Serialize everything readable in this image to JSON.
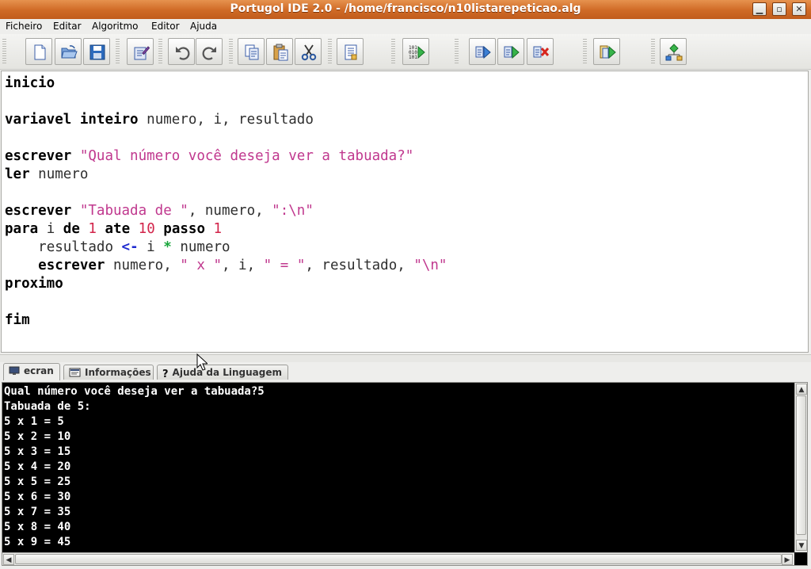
{
  "window": {
    "title": "Portugol IDE 2.0  - /home/francisco/n10listarepeticao.alg",
    "controls": [
      "minimize-icon",
      "maximize-icon",
      "close-icon"
    ]
  },
  "menu": [
    "Ficheiro",
    "Editar",
    "Algoritmo",
    "Editor",
    "Ajuda"
  ],
  "toolbar": {
    "buttons": [
      "new-file-icon",
      "open-folder-icon",
      "save-disk-icon",
      "edit-document-icon",
      "undo-icon",
      "redo-icon",
      "copy-icon",
      "paste-icon",
      "cut-scissors-icon",
      "document-list-icon",
      "compile-binary-icon",
      "run-step-icon",
      "run-icon",
      "stop-icon",
      "run-debug-icon",
      "flowchart-icon"
    ]
  },
  "code": {
    "l1": {
      "kw": "inicio"
    },
    "l3": {
      "kw1": "variavel",
      "kw2": "inteiro",
      "rest": "numero, i, resultado"
    },
    "l5": {
      "kw": "escrever",
      "str": "\"Qual número você deseja ver a tabuada?\""
    },
    "l6": {
      "kw": "ler",
      "rest": "numero"
    },
    "l8": {
      "kw": "escrever",
      "str1": "\"Tabuada de \"",
      "mid": ", numero, ",
      "str2": "\":\\n\""
    },
    "l9": {
      "kw1": "para",
      "v": "i",
      "kw2": "de",
      "n1": "1",
      "kw3": "ate",
      "n2": "10",
      "kw4": "passo",
      "n3": "1"
    },
    "l10": {
      "a": "resultado",
      "op": "<-",
      "b": "i",
      "op2": "*",
      "c": "numero"
    },
    "l11": {
      "kw": "escrever",
      "a": "numero, ",
      "s1": "\" x \"",
      "b": ", i, ",
      "s2": "\" = \"",
      "c": ", resultado, ",
      "s3": "\"\\n\""
    },
    "l12": {
      "kw": "proximo"
    },
    "l14": {
      "kw": "fim"
    }
  },
  "tabs": [
    {
      "label": "ecran",
      "icon": "monitor-icon",
      "active": true
    },
    {
      "label": "Informações",
      "icon": "info-panel-icon",
      "active": false
    },
    {
      "label": "Ajuda da Linguagem",
      "icon": "question-icon",
      "active": false
    }
  ],
  "console": {
    "lines": [
      "Qual número você deseja ver a tabuada?5",
      "Tabuada de 5:",
      "5 x 1 = 5",
      "5 x 2 = 10",
      "5 x 3 = 15",
      "5 x 4 = 20",
      "5 x 5 = 25",
      "5 x 6 = 30",
      "5 x 7 = 35",
      "5 x 8 = 40",
      "5 x 9 = 45"
    ]
  }
}
